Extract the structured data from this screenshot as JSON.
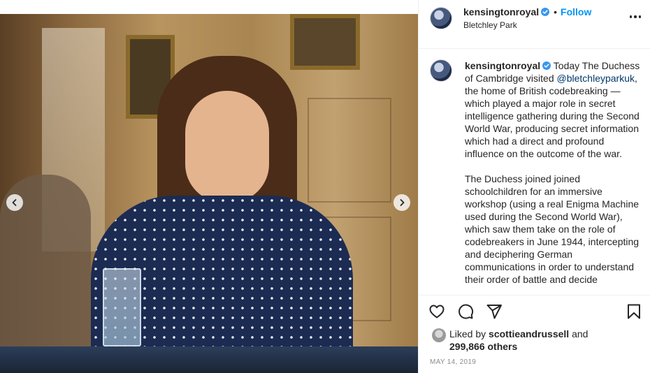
{
  "post": {
    "image_alt": "Photo",
    "nav_prev_icon": "chevron-left-icon",
    "nav_next_icon": "chevron-right-icon"
  },
  "header": {
    "username": "kensingtonroyal",
    "separator": "•",
    "follow_label": "Follow",
    "location": "Bletchley Park",
    "more_icon": "more-horizontal-icon"
  },
  "caption": {
    "username": "kensingtonroyal",
    "para1_before": "Today The Duchess of Cambridge visited ",
    "mention": "@bletchleyparkuk",
    "para1_after": ", the home of British codebreaking — which played a major role in secret intelligence gathering during the Second World War, producing secret information which had a direct and profound influence on the outcome of the war.",
    "para2": "The Duchess joined joined schoolchildren for an immersive workshop (using a real Enigma Machine used during the Second World War), which saw them take on the role of codebreakers in June 1944, intercepting and deciphering German communications in order to understand their order of battle and decide"
  },
  "actions": {
    "like_icon": "heart-icon",
    "comment_icon": "comment-icon",
    "share_icon": "paper-plane-icon",
    "save_icon": "bookmark-icon"
  },
  "likes": {
    "prefix": "Liked by ",
    "user": "scottieandrussell",
    "mid": " and",
    "count": "299,866 others"
  },
  "date": "MAY 14, 2019",
  "colors": {
    "link_blue": "#0095f6",
    "mention": "#00376b",
    "muted": "#8e8e8e",
    "verified": "#3897f0"
  }
}
